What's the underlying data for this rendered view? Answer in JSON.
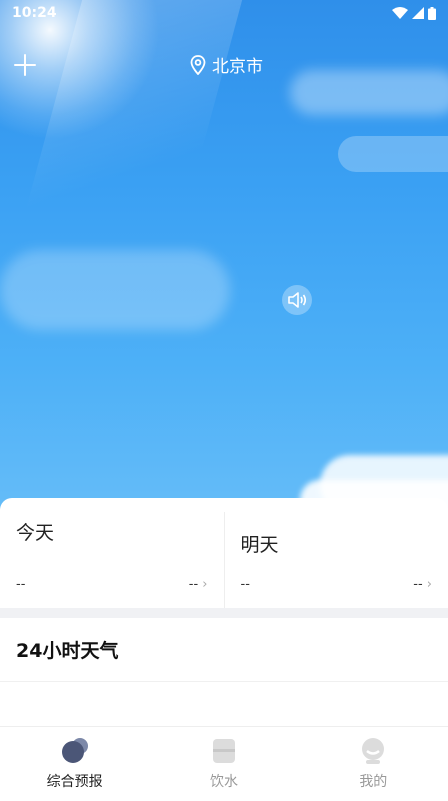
{
  "status_bar": {
    "time": "10:24"
  },
  "header": {
    "location": "北京市"
  },
  "forecast": {
    "today": {
      "label": "今天",
      "left_value": "--",
      "right_value": "--"
    },
    "tomorrow": {
      "label": "明天",
      "left_value": "--",
      "right_value": "--"
    }
  },
  "hourly": {
    "title": "24小时天气"
  },
  "tabs": [
    {
      "label": "综合预报",
      "icon": "cloud-icon",
      "active": true
    },
    {
      "label": "饮水",
      "icon": "cup-icon",
      "active": false
    },
    {
      "label": "我的",
      "icon": "profile-icon",
      "active": false
    }
  ],
  "colors": {
    "sky": "#3aa0f3",
    "active_tab": "#222222",
    "inactive_tab": "#999999"
  }
}
